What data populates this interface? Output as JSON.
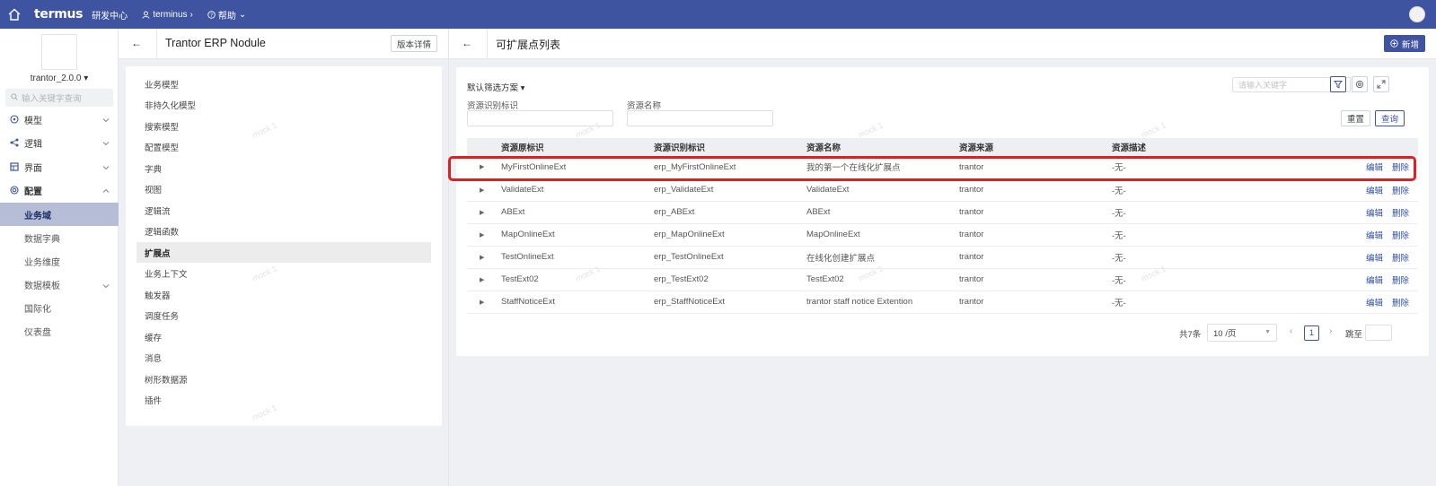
{
  "topbar": {
    "logo": "termus",
    "org": "研发中心",
    "user": "terminus",
    "help": "帮助"
  },
  "sidebar": {
    "version": "trantor_2.0.0",
    "search_placeholder": "输入关键字查询",
    "groups": {
      "model": "模型",
      "logic": "逻辑",
      "ui": "界面",
      "config": "配置"
    },
    "subs": {
      "domain": "业务域",
      "dict": "数据字典",
      "dimension": "业务维度",
      "template": "数据模板",
      "i18n": "国际化",
      "dashboard": "仪表盘"
    }
  },
  "middle": {
    "title": "Trantor ERP Nodule",
    "version_detail": "版本详情",
    "menu": [
      "业务模型",
      "非持久化模型",
      "搜索模型",
      "配置模型",
      "字典",
      "视图",
      "逻辑流",
      "逻辑函数",
      "扩展点",
      "业务上下文",
      "触发器",
      "调度任务",
      "缓存",
      "消息",
      "树形数据源",
      "插件"
    ],
    "active_item": "扩展点"
  },
  "main": {
    "title": "可扩展点列表",
    "add_label": "新增",
    "filter_scheme": "默认筛选方案",
    "keyword_placeholder": "请输入关键字",
    "filters": {
      "res_id_label": "资源识别标识",
      "res_name_label": "资源名称"
    },
    "reset_label": "重置",
    "query_label": "查询",
    "columns": [
      "资源原标识",
      "资源识别标识",
      "资源名称",
      "资源来源",
      "资源描述"
    ],
    "rows": [
      {
        "orig": "MyFirstOnlineExt",
        "id": "erp_MyFirstOnlineExt",
        "name": "我的第一个在线化扩展点",
        "source": "trantor",
        "desc": "-无-"
      },
      {
        "orig": "ValidateExt",
        "id": "erp_ValidateExt",
        "name": "ValidateExt",
        "source": "trantor",
        "desc": "-无-"
      },
      {
        "orig": "ABExt",
        "id": "erp_ABExt",
        "name": "ABExt",
        "source": "trantor",
        "desc": "-无-"
      },
      {
        "orig": "MapOnlineExt",
        "id": "erp_MapOnlineExt",
        "name": "MapOnlineExt",
        "source": "trantor",
        "desc": "-无-"
      },
      {
        "orig": "TestOnlineExt",
        "id": "erp_TestOnlineExt",
        "name": "在线化创建扩展点",
        "source": "trantor",
        "desc": "-无-"
      },
      {
        "orig": "TestExt02",
        "id": "erp_TestExt02",
        "name": "TestExt02",
        "source": "trantor",
        "desc": "-无-"
      },
      {
        "orig": "StaffNoticeExt",
        "id": "erp_StaffNoticeExt",
        "name": "trantor staff notice Extention",
        "source": "trantor",
        "desc": "-无-"
      }
    ],
    "edit_label": "编辑",
    "delete_label": "删除",
    "pager": {
      "total": "共7条",
      "page_size": "10 /页",
      "current_page": "1",
      "jump_label": "跳至"
    }
  },
  "watermark": "mock 1",
  "colors": {
    "brand": "#3e54a0",
    "link": "#2f4fa2",
    "highlight": "#e02020",
    "active_nav": "#b6bdd6"
  }
}
